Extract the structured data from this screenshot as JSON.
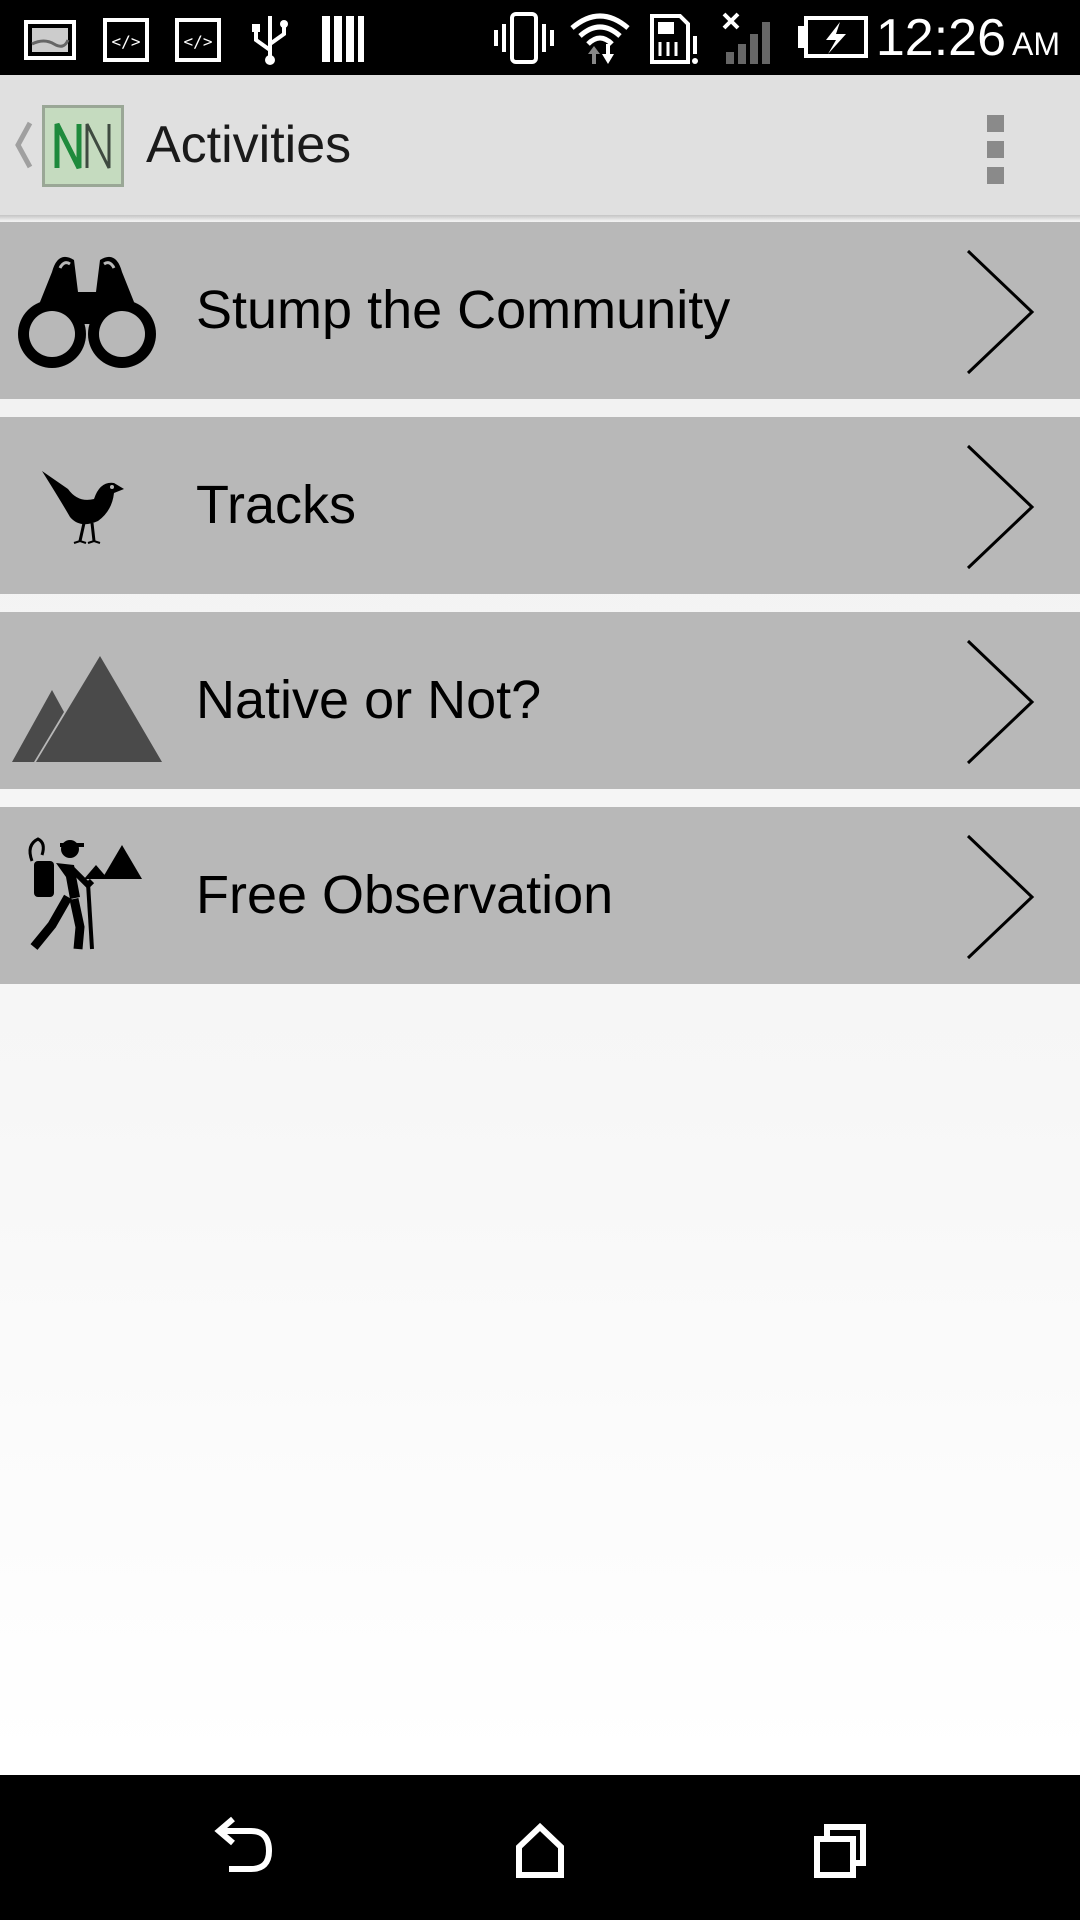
{
  "status_bar": {
    "time": "12:26",
    "ampm": "AM",
    "left_icons": [
      "image-notification-icon",
      "code-notification-icon",
      "code-notification-icon",
      "usb-icon",
      "stack-icon"
    ],
    "right_icons": [
      "vibrate-icon",
      "wifi-icon",
      "sd-card-alert-icon",
      "no-signal-icon",
      "battery-charging-icon"
    ]
  },
  "action_bar": {
    "title": "Activities",
    "logo_text": "NN",
    "up_icon": "chevron-left-icon",
    "menu_icon": "overflow-menu-icon"
  },
  "activities": [
    {
      "label": "Stump the Community",
      "icon": "binoculars-icon"
    },
    {
      "label": "Tracks",
      "icon": "bird-icon"
    },
    {
      "label": "Native or Not?",
      "icon": "mountains-icon"
    },
    {
      "label": "Free Observation",
      "icon": "hiker-icon"
    }
  ],
  "nav_bar": {
    "buttons": [
      "back-icon",
      "home-icon",
      "recent-apps-icon"
    ]
  },
  "colors": {
    "status_bar": "#000000",
    "action_bar": "#e0e0e0",
    "row_background": "#b8b8b8",
    "logo_green": "#1e8a3c"
  }
}
